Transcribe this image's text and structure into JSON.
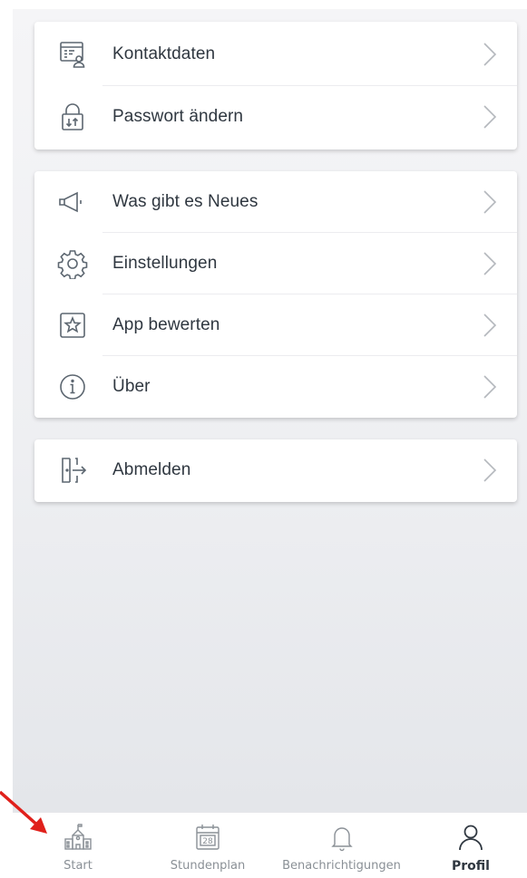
{
  "account_section": {
    "items": [
      {
        "label": "Kontaktdaten",
        "icon": "contact-card-icon"
      },
      {
        "label": "Passwort ändern",
        "icon": "lock-icon"
      }
    ]
  },
  "app_section": {
    "items": [
      {
        "label": "Was gibt es Neues",
        "icon": "megaphone-icon"
      },
      {
        "label": "Einstellungen",
        "icon": "gear-icon"
      },
      {
        "label": "App bewerten",
        "icon": "star-icon"
      },
      {
        "label": "Über",
        "icon": "info-icon"
      }
    ]
  },
  "logout_section": {
    "items": [
      {
        "label": "Abmelden",
        "icon": "logout-icon"
      }
    ]
  },
  "tabbar": {
    "active": "Profil",
    "tabs": [
      {
        "label": "Start",
        "icon": "school-icon"
      },
      {
        "label": "Stundenplan",
        "icon": "calendar-icon",
        "badge": "28"
      },
      {
        "label": "Benachrichtigungen",
        "icon": "bell-icon"
      },
      {
        "label": "Profil",
        "icon": "user-icon"
      }
    ]
  },
  "colors": {
    "text": "#2f3740",
    "icon": "#5c6670",
    "chevron": "#b4b8bd",
    "annotation_arrow": "#e0201b"
  }
}
